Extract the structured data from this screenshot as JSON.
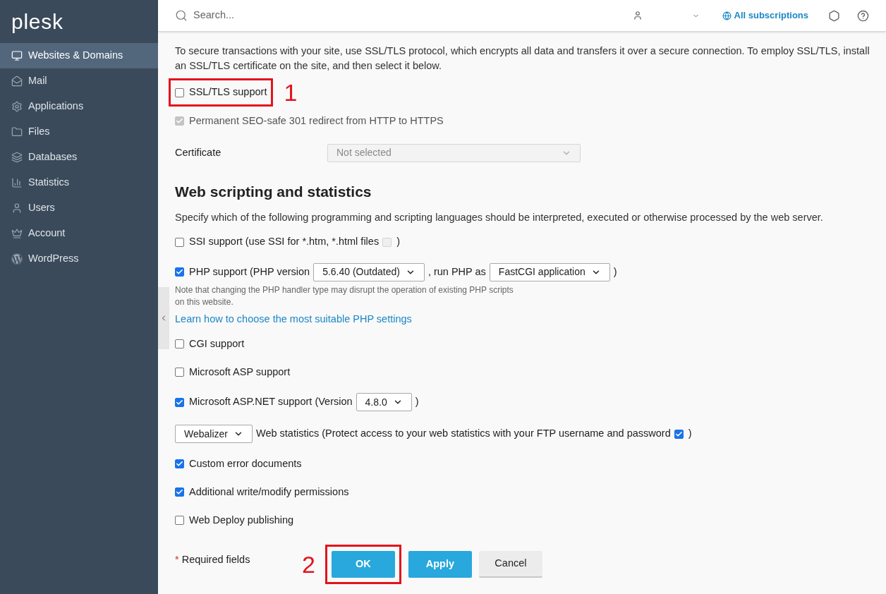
{
  "logo": "plesk",
  "sidebar": {
    "items": [
      {
        "label": "Websites & Domains",
        "selected": true
      },
      {
        "label": "Mail",
        "selected": false
      },
      {
        "label": "Applications",
        "selected": false
      },
      {
        "label": "Files",
        "selected": false
      },
      {
        "label": "Databases",
        "selected": false
      },
      {
        "label": "Statistics",
        "selected": false
      },
      {
        "label": "Users",
        "selected": false
      },
      {
        "label": "Account",
        "selected": false
      },
      {
        "label": "WordPress",
        "selected": false
      }
    ]
  },
  "topbar": {
    "search": {
      "placeholder": "Search..."
    },
    "subscriptions": "All subscriptions"
  },
  "ssl": {
    "description": "To secure transactions with your site, use SSL/TLS protocol, which encrypts all data and transfers it over a secure connection. To employ SSL/TLS, install an SSL/TLS certificate on the site, and then select it below.",
    "options": [
      {
        "label": "SSL/TLS support",
        "checked": false,
        "disabled": false,
        "callout": "1"
      },
      {
        "label": "Permanent SEO-safe 301 redirect from HTTP to HTTPS",
        "checked": true,
        "disabled": true
      }
    ],
    "certificate": {
      "label": "Certificate",
      "value": "Not selected",
      "disabled": true
    }
  },
  "scripting": {
    "title": "Web scripting and statistics",
    "description": "Specify which of the following programming and scripting languages should be interpreted, executed or otherwise processed by the web server.",
    "rows": [
      {
        "kind": "line",
        "parts": [
          {
            "kind": "checkbox",
            "checked": false,
            "disabled": false
          },
          {
            "kind": "text",
            "text": "SSI support (use SSI for *.htm, *.html files"
          },
          {
            "kind": "checkbox",
            "checked": false,
            "disabled": true
          },
          {
            "kind": "text",
            "text": ")"
          }
        ]
      },
      {
        "kind": "line",
        "parts": [
          {
            "kind": "checkbox",
            "checked": true,
            "disabled": false
          },
          {
            "kind": "text",
            "text": "PHP support (PHP version"
          },
          {
            "kind": "select",
            "value": "5.6.40 (Outdated)"
          },
          {
            "kind": "text",
            "text": ", run PHP as"
          },
          {
            "kind": "select",
            "value": "FastCGI application"
          },
          {
            "kind": "text",
            "text": ")"
          }
        ]
      },
      {
        "kind": "note",
        "text": "Note that changing the PHP handler type may disrupt the operation of existing PHP scripts on this website."
      },
      {
        "kind": "link",
        "text": "Learn how to choose the most suitable PHP settings"
      },
      {
        "kind": "line",
        "parts": [
          {
            "kind": "checkbox",
            "checked": false,
            "disabled": false
          },
          {
            "kind": "text",
            "text": "CGI support"
          }
        ]
      },
      {
        "kind": "line",
        "parts": [
          {
            "kind": "checkbox",
            "checked": false,
            "disabled": false
          },
          {
            "kind": "text",
            "text": "Microsoft ASP support"
          }
        ]
      },
      {
        "kind": "line",
        "parts": [
          {
            "kind": "checkbox",
            "checked": true,
            "disabled": false
          },
          {
            "kind": "text",
            "text": "Microsoft ASP.NET support (Version"
          },
          {
            "kind": "select",
            "value": "4.8.0"
          },
          {
            "kind": "text",
            "text": ")"
          }
        ]
      },
      {
        "kind": "line",
        "parts": [
          {
            "kind": "select",
            "value": "Webalizer"
          },
          {
            "kind": "text",
            "text": "Web statistics (Protect access to your web statistics with your FTP username and password"
          },
          {
            "kind": "checkbox",
            "checked": true,
            "disabled": false
          },
          {
            "kind": "text",
            "text": ")"
          }
        ]
      },
      {
        "kind": "line",
        "parts": [
          {
            "kind": "checkbox",
            "checked": true,
            "disabled": false
          },
          {
            "kind": "text",
            "text": "Custom error documents"
          }
        ]
      },
      {
        "kind": "line",
        "parts": [
          {
            "kind": "checkbox",
            "checked": true,
            "disabled": false
          },
          {
            "kind": "text",
            "text": "Additional write/modify permissions"
          }
        ]
      },
      {
        "kind": "line",
        "parts": [
          {
            "kind": "checkbox",
            "checked": false,
            "disabled": false
          },
          {
            "kind": "text",
            "text": "Web Deploy publishing"
          }
        ]
      }
    ]
  },
  "footer": {
    "required_mark": "*",
    "required": "Required fields",
    "buttons": [
      {
        "label": "OK",
        "kind": "primary",
        "callout": "2"
      },
      {
        "label": "Apply",
        "kind": "primary"
      },
      {
        "label": "Cancel",
        "kind": "secondary"
      }
    ]
  }
}
